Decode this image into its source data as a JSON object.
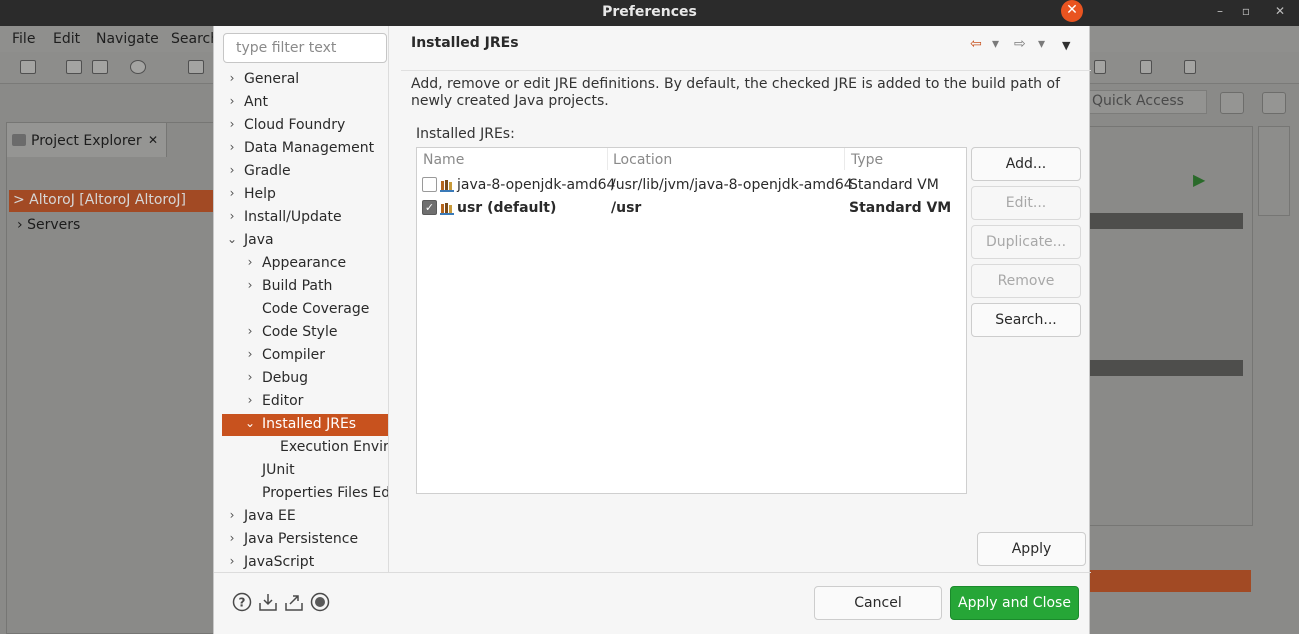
{
  "window": {
    "title": "Preferences"
  },
  "ide_background": {
    "menu": [
      "File",
      "Edit",
      "Navigate",
      "Search"
    ],
    "quick_access": "Quick Access",
    "project_explorer": {
      "tab_label": "Project Explorer",
      "tab_close": "✕",
      "items": [
        "> AltoroJ [AltoroJ AltoroJ]",
        "Servers"
      ]
    }
  },
  "filter": {
    "placeholder": "type filter text",
    "value": ""
  },
  "tree": {
    "items": [
      {
        "label": "General",
        "level": 0,
        "expander": "›",
        "selected": false
      },
      {
        "label": "Ant",
        "level": 0,
        "expander": "›",
        "selected": false
      },
      {
        "label": "Cloud Foundry",
        "level": 0,
        "expander": "›",
        "selected": false
      },
      {
        "label": "Data Management",
        "level": 0,
        "expander": "›",
        "selected": false
      },
      {
        "label": "Gradle",
        "level": 0,
        "expander": "›",
        "selected": false
      },
      {
        "label": "Help",
        "level": 0,
        "expander": "›",
        "selected": false
      },
      {
        "label": "Install/Update",
        "level": 0,
        "expander": "›",
        "selected": false
      },
      {
        "label": "Java",
        "level": 0,
        "expander": "⌄",
        "selected": false
      },
      {
        "label": "Appearance",
        "level": 1,
        "expander": "›",
        "selected": false
      },
      {
        "label": "Build Path",
        "level": 1,
        "expander": "›",
        "selected": false
      },
      {
        "label": "Code Coverage",
        "level": 1,
        "expander": "",
        "selected": false
      },
      {
        "label": "Code Style",
        "level": 1,
        "expander": "›",
        "selected": false
      },
      {
        "label": "Compiler",
        "level": 1,
        "expander": "›",
        "selected": false
      },
      {
        "label": "Debug",
        "level": 1,
        "expander": "›",
        "selected": false
      },
      {
        "label": "Editor",
        "level": 1,
        "expander": "›",
        "selected": false
      },
      {
        "label": "Installed JREs",
        "level": 1,
        "expander": "⌄",
        "selected": true
      },
      {
        "label": "Execution Environments",
        "level": 2,
        "expander": "",
        "selected": false
      },
      {
        "label": "JUnit",
        "level": 1,
        "expander": "",
        "selected": false
      },
      {
        "label": "Properties Files Editor",
        "level": 1,
        "expander": "",
        "selected": false
      },
      {
        "label": "Java EE",
        "level": 0,
        "expander": "›",
        "selected": false
      },
      {
        "label": "Java Persistence",
        "level": 0,
        "expander": "›",
        "selected": false
      },
      {
        "label": "JavaScript",
        "level": 0,
        "expander": "›",
        "selected": false
      }
    ]
  },
  "page": {
    "title": "Installed JREs",
    "description": "Add, remove or edit JRE definitions. By default, the checked JRE is added to the build path of newly created Java projects.",
    "list_label": "Installed JREs:"
  },
  "nav": {
    "back": "⇦",
    "forward": "⇨",
    "dropdown": "▾",
    "menu": "▼"
  },
  "table": {
    "columns": [
      "Name",
      "Location",
      "Type"
    ],
    "rows": [
      {
        "checked": false,
        "name": "java-8-openjdk-amd64",
        "location": "/usr/lib/jvm/java-8-openjdk-amd64",
        "type": "Standard VM",
        "bold": false
      },
      {
        "checked": true,
        "name": "usr (default)",
        "location": "/usr",
        "type": "Standard VM",
        "bold": true
      }
    ]
  },
  "buttons": {
    "add": "Add...",
    "edit": "Edit...",
    "duplicate": "Duplicate...",
    "remove": "Remove",
    "search": "Search...",
    "apply": "Apply",
    "cancel": "Cancel",
    "apply_and_close": "Apply and Close"
  },
  "colors": {
    "selection": "#c8521e",
    "primary_button": "#26a637",
    "close_button": "#e95420"
  }
}
